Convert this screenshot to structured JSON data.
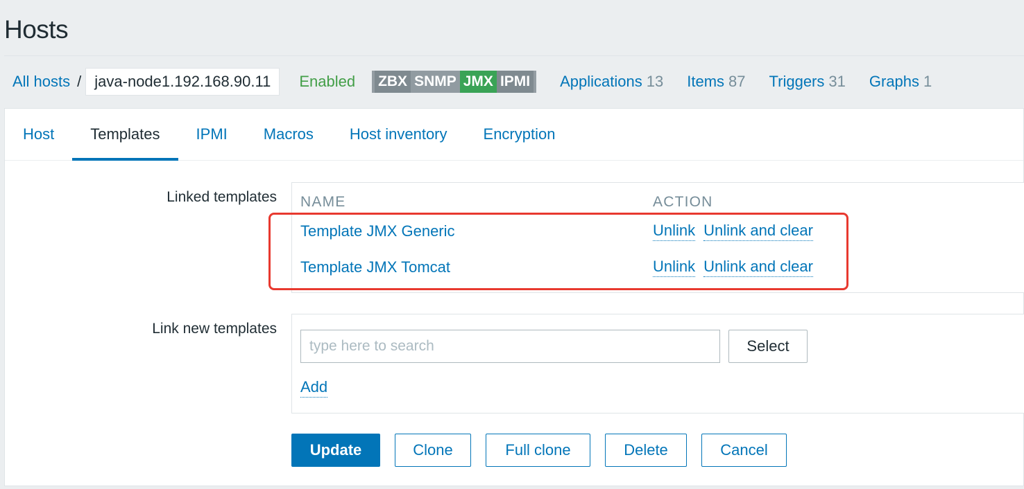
{
  "page": {
    "title": "Hosts"
  },
  "breadcrumb": {
    "all_hosts": "All hosts",
    "separator": "/",
    "host": "java-node1.192.168.90.11",
    "status": "Enabled"
  },
  "availability": [
    "ZBX",
    "SNMP",
    "JMX",
    "IPMI"
  ],
  "availability_colors": {
    "active": "#3aa356",
    "inactive": "#7f8a90"
  },
  "nav_links": [
    {
      "label": "Applications",
      "count": "13"
    },
    {
      "label": "Items",
      "count": "87"
    },
    {
      "label": "Triggers",
      "count": "31"
    },
    {
      "label": "Graphs",
      "count": "1"
    }
  ],
  "tabs": [
    {
      "label": "Host"
    },
    {
      "label": "Templates",
      "active": true
    },
    {
      "label": "IPMI"
    },
    {
      "label": "Macros"
    },
    {
      "label": "Host inventory"
    },
    {
      "label": "Encryption"
    }
  ],
  "linked_templates": {
    "label": "Linked templates",
    "columns": {
      "name": "NAME",
      "action": "ACTION"
    },
    "rows": [
      {
        "name": "Template JMX Generic",
        "unlink": "Unlink",
        "unlink_clear": "Unlink and clear"
      },
      {
        "name": "Template JMX Tomcat",
        "unlink": "Unlink",
        "unlink_clear": "Unlink and clear"
      }
    ]
  },
  "link_new": {
    "label": "Link new templates",
    "placeholder": "type here to search",
    "select_label": "Select",
    "add_label": "Add"
  },
  "buttons": {
    "update": "Update",
    "clone": "Clone",
    "full_clone": "Full clone",
    "delete": "Delete",
    "cancel": "Cancel"
  },
  "colors": {
    "link": "#0275b8",
    "enabled": "#429e47",
    "highlight": "#e8392f"
  }
}
